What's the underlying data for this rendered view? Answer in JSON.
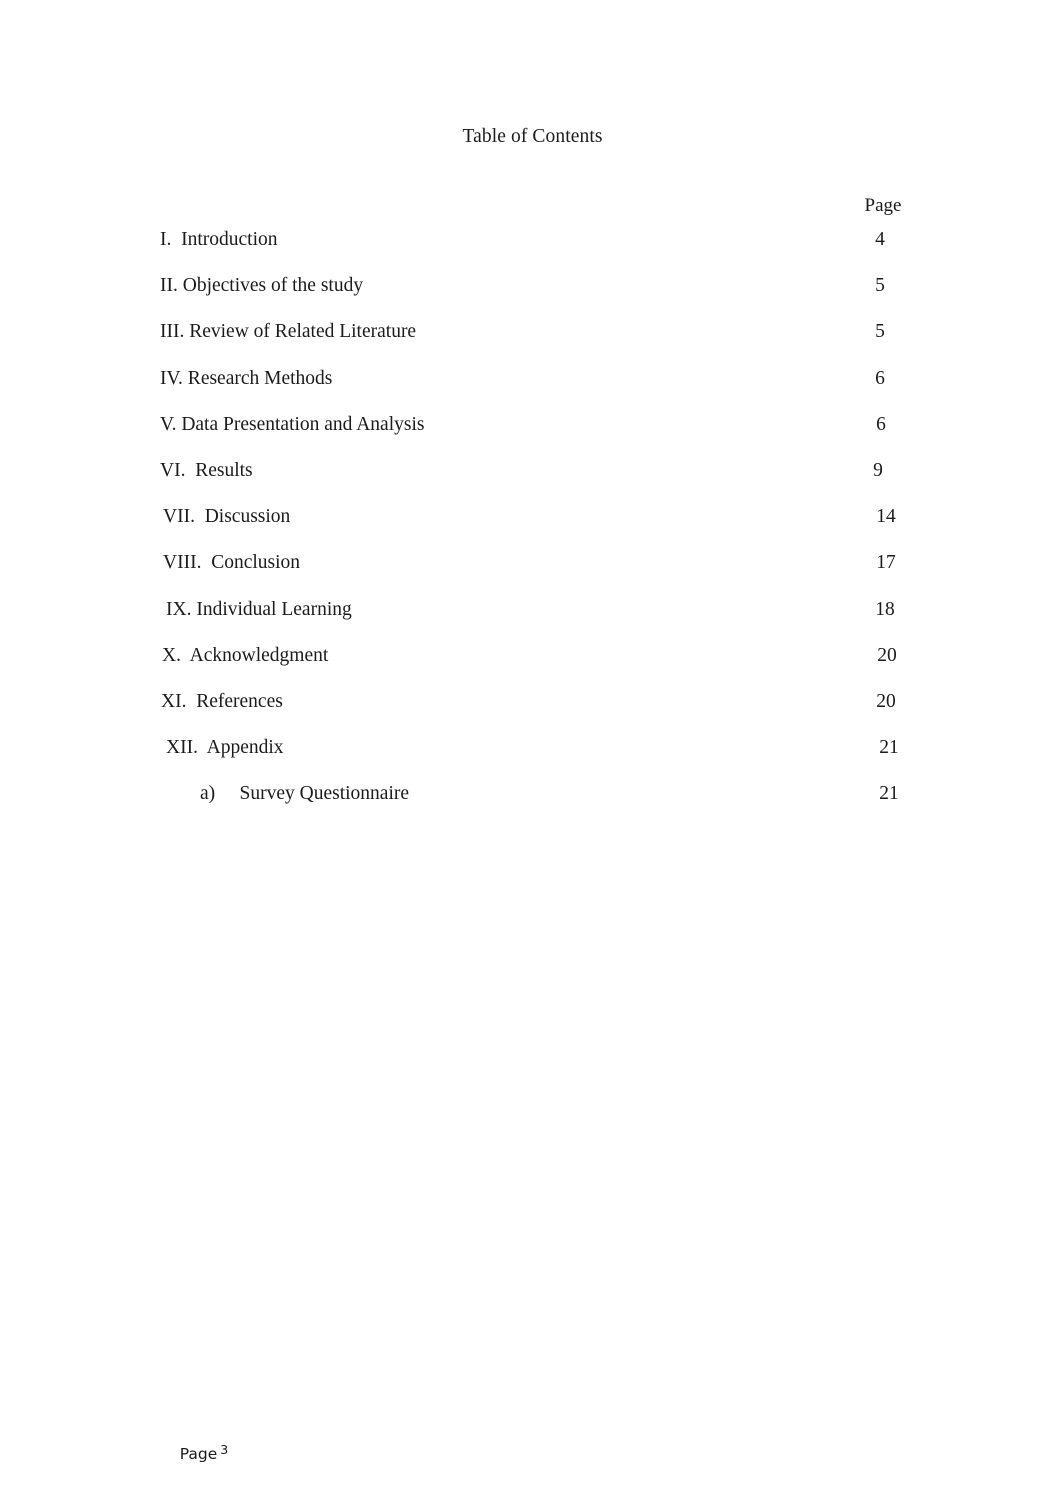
{
  "document": {
    "title": "Table of Contents",
    "page_column_header": "Page",
    "footer": {
      "label": "Page",
      "number": "3"
    }
  },
  "toc": {
    "entries": [
      {
        "label": "I.  Introduction",
        "page": "4",
        "indent": 160,
        "page_center": 880
      },
      {
        "label": "II. Objectives of the study",
        "page": "5",
        "indent": 160,
        "page_center": 880
      },
      {
        "label": "III. Review of Related Literature",
        "page": "5",
        "indent": 160,
        "page_center": 880
      },
      {
        "label": "IV. Research Methods",
        "page": "6",
        "indent": 160,
        "page_center": 880
      },
      {
        "label": "V. Data Presentation and Analysis",
        "page": "6",
        "indent": 160,
        "page_center": 881
      },
      {
        "label": "VI.  Results",
        "page": "9",
        "indent": 160,
        "page_center": 878
      },
      {
        "label": "VII.  Discussion",
        "page": "14",
        "indent": 163,
        "page_center": 886
      },
      {
        "label": "VIII.  Conclusion",
        "page": "17",
        "indent": 163,
        "page_center": 886
      },
      {
        "label": "IX. Individual Learning",
        "page": "18",
        "indent": 166,
        "page_center": 885
      },
      {
        "label": "X.  Acknowledgment",
        "page": "20",
        "indent": 162,
        "page_center": 887
      },
      {
        "label": "XI.  References",
        "page": "20",
        "indent": 161,
        "page_center": 886
      },
      {
        "label": "XII.  Appendix",
        "page": "21",
        "indent": 166,
        "page_center": 889
      },
      {
        "label": "a)     Survey Questionnaire",
        "page": "21",
        "indent": 200,
        "page_center": 889
      }
    ]
  }
}
